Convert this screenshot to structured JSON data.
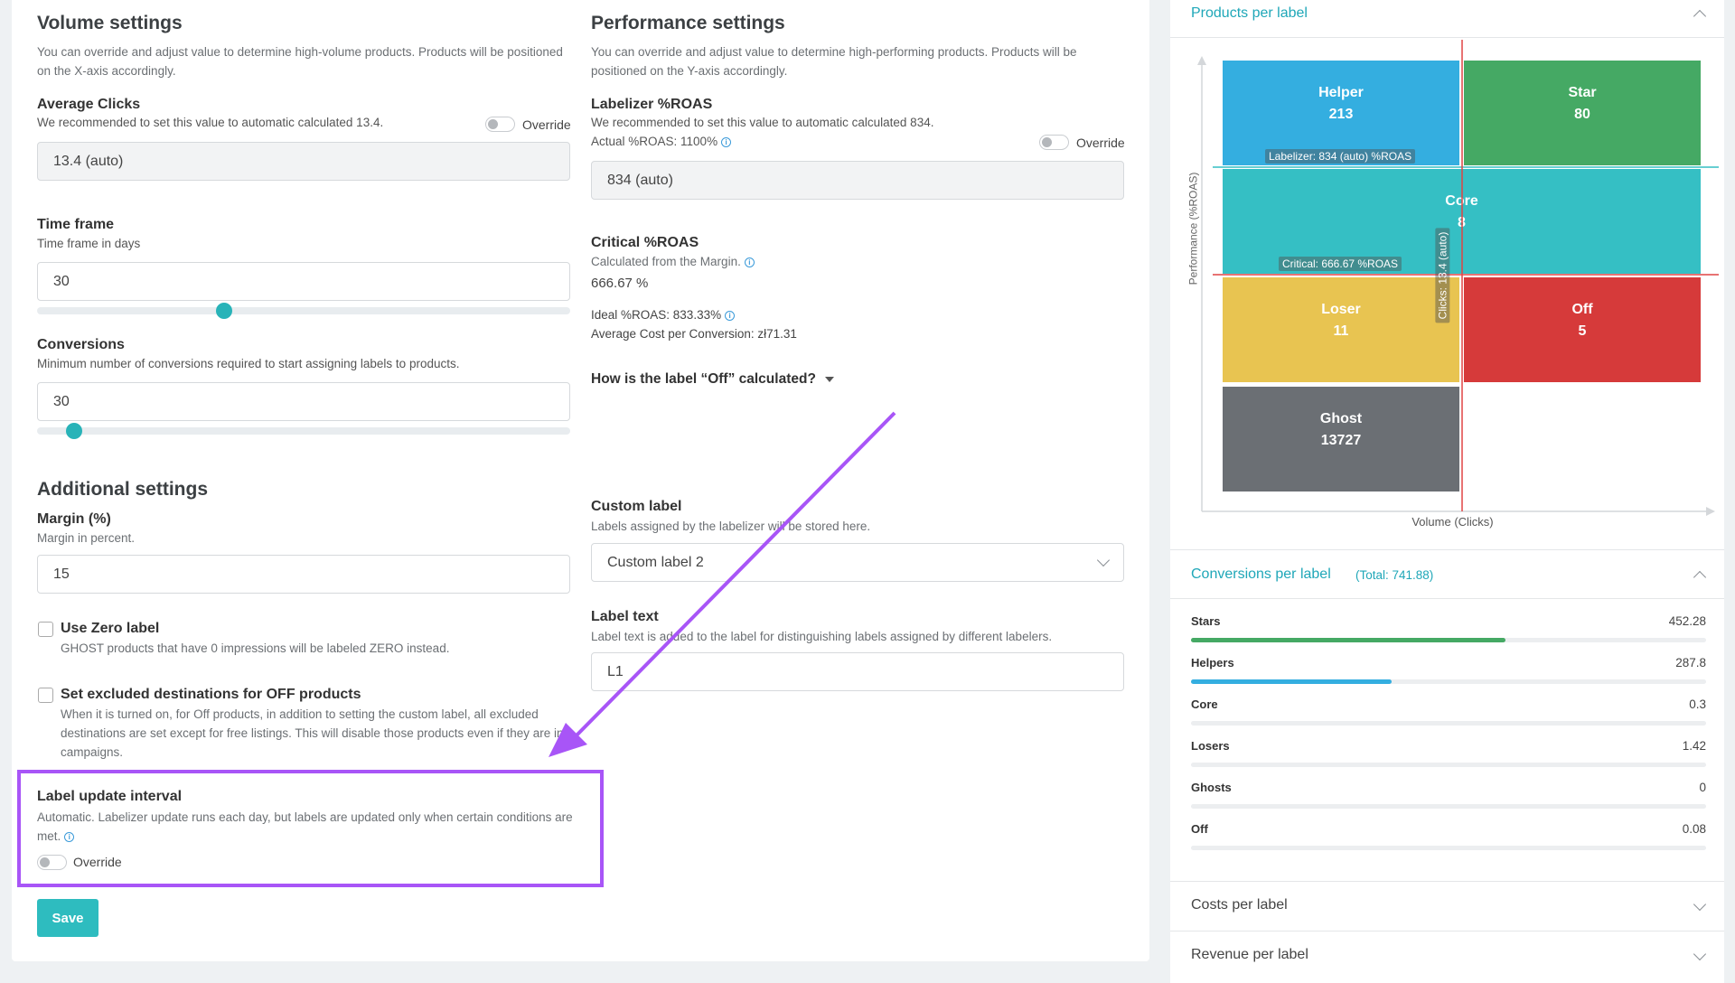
{
  "volume": {
    "title": "Volume settings",
    "desc_1": "You can override and adjust value to determine high-volume products. Products will be positioned",
    "desc_2": "on the X-axis accordingly.",
    "avg_clicks": {
      "label": "Average Clicks",
      "hint": "We recommended to set this value to automatic calculated 13.4.",
      "override": "Override",
      "value": "13.4 (auto)"
    },
    "time_frame": {
      "label": "Time frame",
      "hint": "Time frame in days",
      "value": "30",
      "slider_fraction": 0.35
    },
    "conversions": {
      "label": "Conversions",
      "hint": "Minimum number of conversions required to start assigning labels to products.",
      "value": "30",
      "slider_fraction": 0.07
    }
  },
  "performance": {
    "title": "Performance settings",
    "desc_1": "You can override and adjust value to determine high-performing products. Products will be",
    "desc_2": "positioned on the Y-axis accordingly.",
    "labelizer": {
      "label": "Labelizer %ROAS",
      "hint": "We recommended to set this value to automatic calculated 834.",
      "actual": "Actual %ROAS: 1100%",
      "override": "Override",
      "value": "834 (auto)"
    },
    "critical": {
      "label": "Critical %ROAS",
      "hint": "Calculated from the Margin.",
      "value": "666.67 %",
      "ideal": "Ideal %ROAS: 833.33%",
      "avg_cost": "Average Cost per Conversion: zł71.31"
    },
    "off_question": "How is the label “Off” calculated?"
  },
  "additional": {
    "title": "Additional settings",
    "margin": {
      "label": "Margin (%)",
      "hint": "Margin in percent.",
      "value": "15"
    },
    "zero": {
      "label": "Use Zero label",
      "hint": "GHOST products that have 0 impressions will be labeled ZERO instead."
    },
    "excluded": {
      "label": "Set excluded destinations for OFF products",
      "hint_1": "When it is turned on, for Off products, in addition to setting the custom label, all excluded",
      "hint_2": "destinations are set except for free listings. This will disable those products even if they are in",
      "hint_3": "campaigns."
    },
    "interval": {
      "label": "Label update interval",
      "hint_1": "Automatic. Labelizer update runs each day, but labels are updated only when certain conditions are",
      "hint_2": "met.",
      "override": "Override"
    },
    "custom_label": {
      "label": "Custom label",
      "hint": "Labels assigned by the labelizer will be stored here.",
      "value": "Custom label 2"
    },
    "label_text": {
      "label": "Label text",
      "hint": "Label text is added to the label for distinguishing labels assigned by different labelers.",
      "value": "L1"
    },
    "save": "Save"
  },
  "products_panel": {
    "title": "Products per label",
    "y_axis": "Performance (%ROAS)",
    "x_axis": "Volume (Clicks)",
    "quadrants": [
      {
        "name": "Helper",
        "count": "213",
        "color": "#34aee0"
      },
      {
        "name": "Star",
        "count": "80",
        "color": "#45a964"
      },
      {
        "name": "Core",
        "count": "8",
        "color": "#35bfc4"
      },
      {
        "name": "Loser",
        "count": "11",
        "color": "#e8c451"
      },
      {
        "name": "Off",
        "count": "5",
        "color": "#d63a3a"
      },
      {
        "name": "Ghost",
        "count": "13727",
        "color": "#6b6f74"
      }
    ],
    "labelizer_line": "Labelizer: 834 (auto) %ROAS",
    "critical_line": "Critical: 666.67 %ROAS",
    "clicks_line": "Clicks: 13.4 (auto)"
  },
  "conversions_panel": {
    "title": "Conversions per label",
    "total": "(Total: 741.88)",
    "rows": [
      {
        "label": "Stars",
        "value": "452.28",
        "fraction": 0.61,
        "color": "#45a964"
      },
      {
        "label": "Helpers",
        "value": "287.8",
        "fraction": 0.39,
        "color": "#34aee0"
      },
      {
        "label": "Core",
        "value": "0.3",
        "fraction": 0.0,
        "color": "#35bfc4"
      },
      {
        "label": "Losers",
        "value": "1.42",
        "fraction": 0.0,
        "color": "#e8c451"
      },
      {
        "label": "Ghosts",
        "value": "0",
        "fraction": 0.0,
        "color": "#6b6f74"
      },
      {
        "label": "Off",
        "value": "0.08",
        "fraction": 0.0,
        "color": "#d63a3a"
      }
    ]
  },
  "costs_panel": {
    "title": "Costs per label"
  },
  "revenue_panel": {
    "title": "Revenue per label"
  },
  "colors": {
    "accent": "#2ebcbf",
    "highlight": "#a855f7",
    "link": "#1fa7b8"
  }
}
